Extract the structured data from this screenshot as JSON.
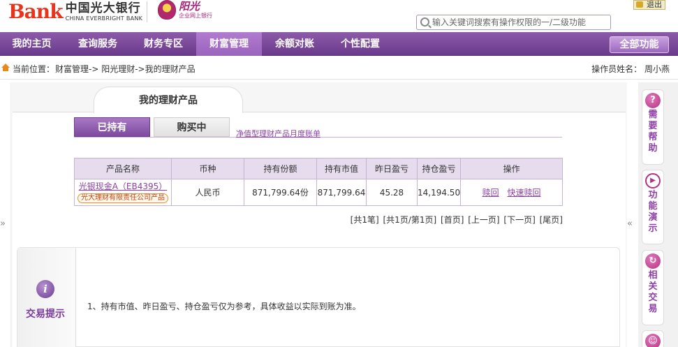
{
  "header": {
    "logo_mark": "Bank",
    "logo_cn": "中国光大银行",
    "logo_en": "CHINA EVERBRIGHT BANK",
    "sub_logo_main": "阳光",
    "sub_logo_sub": "企业网上银行",
    "exit_label": "退出",
    "search_placeholder": "输入关键词搜索有操作权限的一/二级功能"
  },
  "nav": {
    "items": [
      "我的主页",
      "查询服务",
      "财务专区",
      "财富管理",
      "余额对账",
      "个性配置"
    ],
    "active_index": 3,
    "all_label": "全部功能"
  },
  "breadcrumb": {
    "label": "当前位置：",
    "path": "财富管理-> 阳光理财->我的理财产品",
    "operator": "操作员姓名： 周小燕"
  },
  "page": {
    "title": "我的理财产品",
    "tabs": [
      "已持有",
      "购买中"
    ],
    "active_tab": 0,
    "statement_link": "净值型理财产品月度账单"
  },
  "table": {
    "headers": [
      "产品名称",
      "币种",
      "持有份额",
      "持有市值",
      "昨日盈亏",
      "持仓盈亏",
      "操作"
    ],
    "rows": [
      {
        "name": "光银现金A（EB4395）",
        "issuer": "光大理财有限责任公司产品",
        "currency": "人民币",
        "shares": "871,799.64份",
        "market_value": "871,799.64",
        "yesterday_pl": "45.28",
        "position_pl": "14,194.50",
        "ops": [
          "赎回",
          "快速赎回"
        ]
      }
    ]
  },
  "pager": [
    "[共1笔]",
    "[共1页/第1页]",
    "[首页]",
    "[上一页]",
    "[下一页]",
    "[尾页]"
  ],
  "tips": {
    "title": "交易提示",
    "text": "1、持有市值、昨日盈亏、持仓盈亏仅为参考，具体收益以实际到账为准。"
  },
  "rail": {
    "help_label": "需要帮助",
    "demo_label": "功能演示",
    "related_label": "相关交易"
  },
  "colors": {
    "brand_purple": "#7d4a9e",
    "link_purple": "#8e3fa7",
    "logo_red": "#e8341c"
  }
}
